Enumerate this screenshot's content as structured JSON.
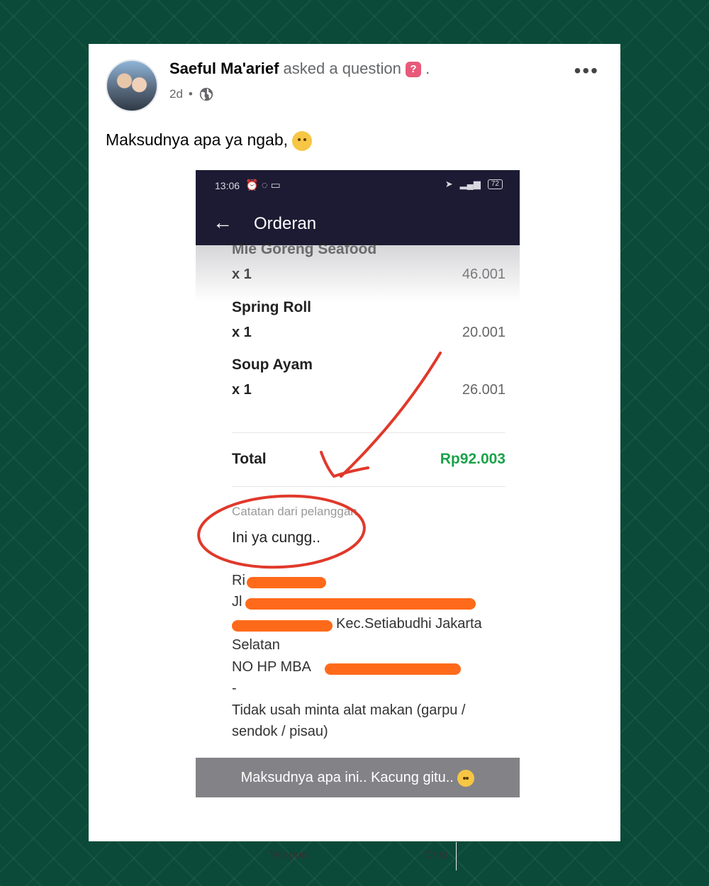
{
  "post": {
    "author": "Saeful Ma'arief",
    "action": "asked a question",
    "badge": "?",
    "time": "2d",
    "dot": "•",
    "caption": "Maksudnya apa ya ngab,",
    "more": "•••"
  },
  "phone": {
    "status_time": "13:06",
    "battery": "72",
    "app_title": "Orderan",
    "items": [
      {
        "name": "Mie Goreng Seafood",
        "qty": "x 1",
        "price": "46.001"
      },
      {
        "name": "Spring Roll",
        "qty": "x 1",
        "price": "20.001"
      },
      {
        "name": "Soup Ayam",
        "qty": "x 1",
        "price": "26.001"
      }
    ],
    "total_label": "Total",
    "total_value": "Rp92.003",
    "note_label": "Catatan dari pelanggan",
    "note_text": "Ini ya cungg..",
    "address_lines": [
      "Ri",
      "Jl",
      "Kec.Setiabudhi Jakarta",
      "Selatan",
      "NO HP MBA",
      "-",
      "Tidak usah minta alat makan (garpu /",
      "sendok / pisau)"
    ],
    "overlay_caption": "Maksudnya apa ini.. Kacung gitu..",
    "nav_phone": "Telepon",
    "nav_chat": "Chat"
  },
  "colors": {
    "background": "#0b4a38",
    "appbar": "#1c1b33",
    "total": "#1aa34a",
    "annotation": "#e0392b",
    "redaction": "#ff6a1a"
  }
}
